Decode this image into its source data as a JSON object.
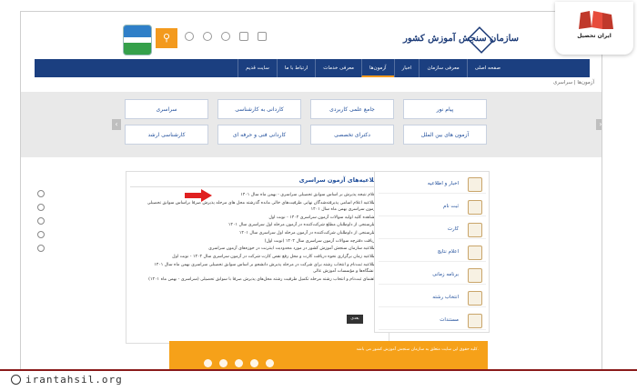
{
  "header": {
    "logo_text": "سازمان سنجش آموزش کشور",
    "search_icon": "search-icon",
    "header_icons": [
      "globe-icon",
      "accessibility-icon",
      "phone-icon",
      "email-icon",
      "rss-icon"
    ]
  },
  "nav": {
    "items": [
      "صفحه اصلی",
      "معرفی سازمان",
      "اخبار",
      "آزمون‌ها",
      "معرفی خدمات",
      "ارتباط با ما",
      "سایت قدیم"
    ]
  },
  "breadcrumb": "آزمون‌ها | سراسری",
  "categories": {
    "row1": [
      "پیام نور",
      "جامع علمی کاربردی",
      "کاردانی به کارشناسی",
      "سراسری"
    ],
    "row2": [
      "آزمون های بین الملل",
      "دکترای تخصصی",
      "کاردانی فنی و حرفه ای",
      "کارشناسی ارشد"
    ]
  },
  "news": {
    "title": "اطلاعیه‌های آزمون سراسری",
    "items": [
      "اعلام نتیجه پذیرش بر اساس سوابق تحصیلی سراسری - بهمن ماه سال ۱۴۰۱",
      "اطلاعیه اعلام اسامی پذیرفته‌شدگان نهایی ظرفیت‌های خالی مانده گذرشته محل های مرحله پذیرش صرفا براساس سوابق تحصیلی آزمون سراسری بهمن ماه سال ۱۴۰۱",
      "مشاهده کلید اولیه سوالات آزمون سراسری ۱۴۰۲ - نوبت اول",
      "نظرسنجی از داوطلبان مطلع شرکت‌کننده در آزمون مرحله اول سراسری سال ۱۴۰۱",
      "نظرسنجی از داوطلبان شرکت‌کننده در آزمون مرحله اول سراسری سال ۱۴۰۱",
      "دریافت دفترچه سوالات آزمون سراسری سال ۱۴۰۲ (نوبت اول)",
      "اطلاعیه سازمان سنجش آموزش کشور در مورد محدودیت اینترنت در حوزه‌های آزمون سراسری",
      "اطلاعیه زمان برگزاری نحوه دریافت کارت و محل رفع نقص کارت شرکت در آزمون سراسری سال ۱۴۰۲ - نوبت اول",
      "اطلاعیه ثبت‌نام و انتخاب رشته برای شرکت در مرحله پذیرش دانشجو بر اساس سوابق تحصیلی سراسری بهمن ماه سال ۱۴۰۱ دانشگاه‌ها و مؤسسات آموزش عالی",
      "راهنمای ثبت‌نام و انتخاب رشته مرحله تکمیل ظرفیت رشته محل‌های پذیرش صرفا با سوابق تحصیلی (سراسری - بهمن ماه ۱۴۰۱)"
    ],
    "more_label": "بعدی"
  },
  "quick_links": [
    "اخبار و اطلاعیه",
    "ثبت نام",
    "کارت",
    "اعلام نتایج",
    "برنامه زمانی",
    "انتخاب رشته",
    "مستندات"
  ],
  "footer": {
    "text": "کلیه حقوق این سایت متعلق به سازمان سنجش آموزش کشور می باشد."
  },
  "watermark": {
    "url": "irantahsil.org",
    "brand": "ایران تحصیل"
  },
  "colors": {
    "nav": "#1b3f80",
    "accent": "#f39a1e",
    "footer": "#f6a119",
    "watermark": "#8a1a1a"
  }
}
